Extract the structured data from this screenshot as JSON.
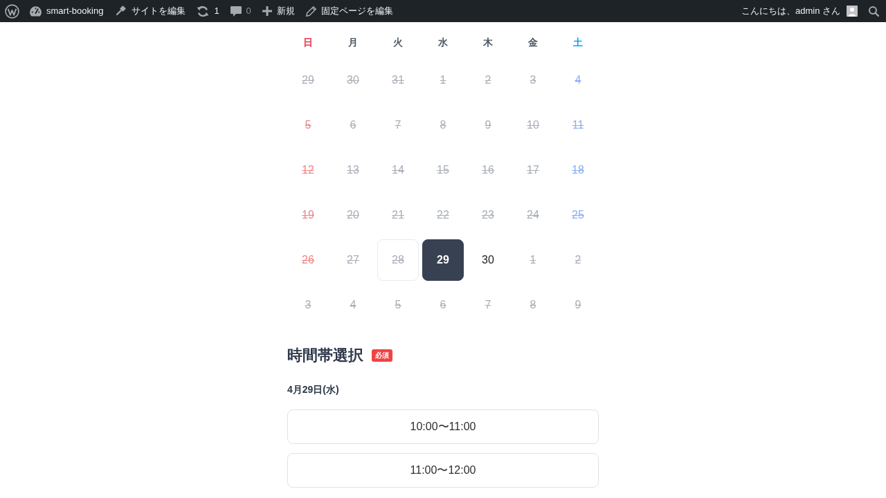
{
  "admin_bar": {
    "items": [
      {
        "kind": "logo"
      },
      {
        "kind": "site",
        "label": "smart-booking"
      },
      {
        "kind": "customize",
        "label": "サイトを編集"
      },
      {
        "kind": "updates",
        "label": "1"
      },
      {
        "kind": "comments",
        "label": "0"
      },
      {
        "kind": "new",
        "label": "新規"
      },
      {
        "kind": "edit",
        "label": "固定ページを編集"
      }
    ],
    "account": {
      "label": "こんにちは、admin さん"
    }
  },
  "calendar": {
    "weekdays": [
      {
        "label": "日",
        "kind": "sunday"
      },
      {
        "label": "月",
        "kind": "weekday"
      },
      {
        "label": "火",
        "kind": "weekday"
      },
      {
        "label": "水",
        "kind": "weekday"
      },
      {
        "label": "木",
        "kind": "weekday"
      },
      {
        "label": "金",
        "kind": "weekday"
      },
      {
        "label": "土",
        "kind": "saturday"
      }
    ],
    "weeks": [
      [
        {
          "day": "29",
          "outside": true,
          "disabled": true,
          "today": false,
          "selected": false
        },
        {
          "day": "30",
          "outside": true,
          "disabled": true,
          "today": false,
          "selected": false
        },
        {
          "day": "31",
          "outside": true,
          "disabled": true,
          "today": false,
          "selected": false
        },
        {
          "day": "1",
          "outside": false,
          "disabled": true,
          "today": false,
          "selected": false
        },
        {
          "day": "2",
          "outside": false,
          "disabled": true,
          "today": false,
          "selected": false
        },
        {
          "day": "3",
          "outside": false,
          "disabled": true,
          "today": false,
          "selected": false
        },
        {
          "day": "4",
          "outside": false,
          "disabled": true,
          "today": false,
          "selected": false
        }
      ],
      [
        {
          "day": "5",
          "outside": false,
          "disabled": true,
          "today": false,
          "selected": false
        },
        {
          "day": "6",
          "outside": false,
          "disabled": true,
          "today": false,
          "selected": false
        },
        {
          "day": "7",
          "outside": false,
          "disabled": true,
          "today": false,
          "selected": false
        },
        {
          "day": "8",
          "outside": false,
          "disabled": true,
          "today": false,
          "selected": false
        },
        {
          "day": "9",
          "outside": false,
          "disabled": true,
          "today": false,
          "selected": false
        },
        {
          "day": "10",
          "outside": false,
          "disabled": true,
          "today": false,
          "selected": false
        },
        {
          "day": "11",
          "outside": false,
          "disabled": true,
          "today": false,
          "selected": false
        }
      ],
      [
        {
          "day": "12",
          "outside": false,
          "disabled": true,
          "today": false,
          "selected": false
        },
        {
          "day": "13",
          "outside": false,
          "disabled": true,
          "today": false,
          "selected": false
        },
        {
          "day": "14",
          "outside": false,
          "disabled": true,
          "today": false,
          "selected": false
        },
        {
          "day": "15",
          "outside": false,
          "disabled": true,
          "today": false,
          "selected": false
        },
        {
          "day": "16",
          "outside": false,
          "disabled": true,
          "today": false,
          "selected": false
        },
        {
          "day": "17",
          "outside": false,
          "disabled": true,
          "today": false,
          "selected": false
        },
        {
          "day": "18",
          "outside": false,
          "disabled": true,
          "today": false,
          "selected": false
        }
      ],
      [
        {
          "day": "19",
          "outside": false,
          "disabled": true,
          "today": false,
          "selected": false
        },
        {
          "day": "20",
          "outside": false,
          "disabled": true,
          "today": false,
          "selected": false
        },
        {
          "day": "21",
          "outside": false,
          "disabled": true,
          "today": false,
          "selected": false
        },
        {
          "day": "22",
          "outside": false,
          "disabled": true,
          "today": false,
          "selected": false
        },
        {
          "day": "23",
          "outside": false,
          "disabled": true,
          "today": false,
          "selected": false
        },
        {
          "day": "24",
          "outside": false,
          "disabled": true,
          "today": false,
          "selected": false
        },
        {
          "day": "25",
          "outside": false,
          "disabled": true,
          "today": false,
          "selected": false
        }
      ],
      [
        {
          "day": "26",
          "outside": false,
          "disabled": true,
          "today": false,
          "selected": false
        },
        {
          "day": "27",
          "outside": false,
          "disabled": true,
          "today": false,
          "selected": false
        },
        {
          "day": "28",
          "outside": false,
          "disabled": true,
          "today": true,
          "selected": false
        },
        {
          "day": "29",
          "outside": false,
          "disabled": false,
          "today": false,
          "selected": true
        },
        {
          "day": "30",
          "outside": false,
          "disabled": false,
          "today": false,
          "selected": false
        },
        {
          "day": "1",
          "outside": true,
          "disabled": true,
          "today": false,
          "selected": false
        },
        {
          "day": "2",
          "outside": true,
          "disabled": true,
          "today": false,
          "selected": false
        }
      ],
      [
        {
          "day": "3",
          "outside": true,
          "disabled": true,
          "today": false,
          "selected": false
        },
        {
          "day": "4",
          "outside": true,
          "disabled": true,
          "today": false,
          "selected": false
        },
        {
          "day": "5",
          "outside": true,
          "disabled": true,
          "today": false,
          "selected": false
        },
        {
          "day": "6",
          "outside": true,
          "disabled": true,
          "today": false,
          "selected": false
        },
        {
          "day": "7",
          "outside": true,
          "disabled": true,
          "today": false,
          "selected": false
        },
        {
          "day": "8",
          "outside": true,
          "disabled": true,
          "today": false,
          "selected": false
        },
        {
          "day": "9",
          "outside": true,
          "disabled": true,
          "today": false,
          "selected": false
        }
      ]
    ]
  },
  "time_section": {
    "title": "時間帯選択",
    "badge": "必須",
    "date": "4月29日(水)",
    "slots": [
      {
        "label": "10:00〜11:00",
        "selected": false
      },
      {
        "label": "11:00〜12:00",
        "selected": false
      }
    ]
  }
}
